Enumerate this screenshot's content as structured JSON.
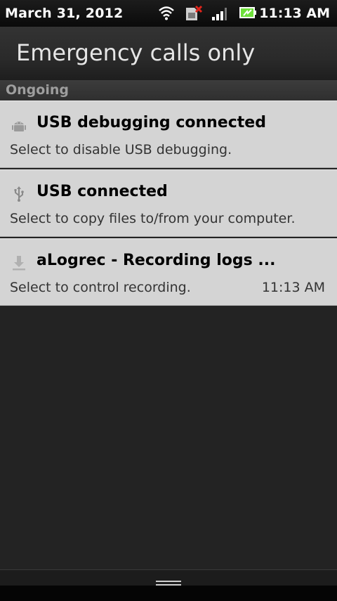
{
  "status_bar": {
    "date": "March 31, 2012",
    "time": "11:13 AM",
    "icons": [
      "wifi-icon",
      "no-sim-icon",
      "signal-icon",
      "battery-charging-icon"
    ]
  },
  "carrier": {
    "label": "Emergency calls only"
  },
  "section": {
    "label": "Ongoing"
  },
  "notifications": [
    {
      "icon": "android-icon",
      "title": "USB debugging connected",
      "text": "Select to disable USB debugging.",
      "time": ""
    },
    {
      "icon": "usb-icon",
      "title": "USB connected",
      "text": "Select to copy files to/from your computer.",
      "time": ""
    },
    {
      "icon": "download-icon",
      "title": "aLogrec - Recording logs ...",
      "text": "Select to control recording.",
      "time": "11:13 AM"
    }
  ],
  "colors": {
    "background": "#232323",
    "notification_bg": "#d4d4d4",
    "battery_green": "#6ee03a",
    "no_sim_red": "#e0241b"
  }
}
